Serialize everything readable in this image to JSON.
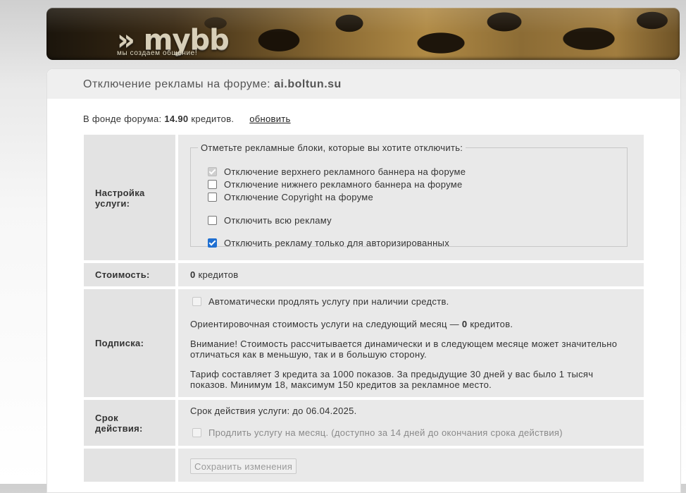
{
  "header": {
    "logo": "» mybb",
    "tagline": "мы   создаем        общение!"
  },
  "page": {
    "title_prefix": "Отключение рекламы на форуме:",
    "forum_domain": "ai.boltun.su"
  },
  "fund": {
    "label": "В фонде форума:",
    "amount": "14.90",
    "unit": "кредитов.",
    "refresh_link": "обновить"
  },
  "settings": {
    "label": "Настройка услуги:",
    "legend": "Отметьте рекламные блоки, которые вы хотите отключить:",
    "options": [
      {
        "label": "Отключение верхнего рекламного баннера на форуме",
        "checked": true,
        "disabled": true
      },
      {
        "label": "Отключение нижнего рекламного баннера на форуме",
        "checked": false,
        "disabled": false
      },
      {
        "label": "Отключение Copyright на форуме",
        "checked": false,
        "disabled": false
      },
      {
        "label": "Отключить всю рекламу",
        "checked": false,
        "disabled": false
      },
      {
        "label": "Отключить рекламу только для авторизированных",
        "checked": true,
        "disabled": false
      }
    ]
  },
  "cost": {
    "label": "Стоимость:",
    "amount": "0",
    "unit": "кредитов"
  },
  "subscription": {
    "label": "Подписка:",
    "auto_renew": "Автоматически продлять услугу при наличии средств.",
    "estimate_prefix": "Ориентировочная стоимость услуги на следующий месяц —",
    "estimate_amount": "0",
    "estimate_unit": "кредитов.",
    "warning": "Внимание! Стоимость рассчитывается динамически и в следующем месяце может значительно отличаться как в меньшую, так и в большую сторону.",
    "tariff": "Тариф составляет 3 кредита за 1000 показов. За предыдущие 30 дней у вас было 1 тысяч показов. Минимум 18, максимум 150 кредитов за рекламное место."
  },
  "validity": {
    "label": "Срок действия:",
    "expires": "Срок действия услуги: до 06.04.2025.",
    "extend": "Продлить услугу на месяц. (доступно за 14 дней до окончания срока действия)"
  },
  "actions": {
    "save_label": "Сохранить изменения"
  },
  "colors": {
    "accent_checkbox": "#1f6fd1",
    "cost_green": "#1e8a1e"
  }
}
